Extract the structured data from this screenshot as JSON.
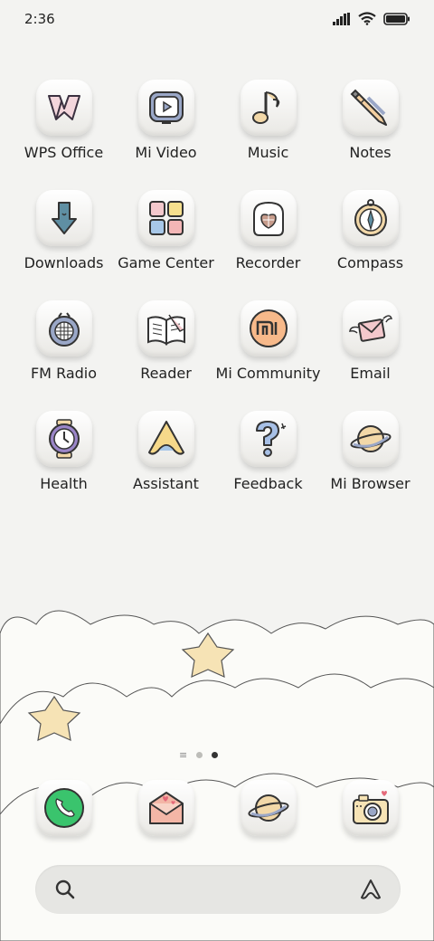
{
  "status_bar": {
    "time": "2:36"
  },
  "apps": [
    {
      "label": "WPS Office",
      "icon": "wps-office-icon"
    },
    {
      "label": "Mi Video",
      "icon": "mi-video-icon"
    },
    {
      "label": "Music",
      "icon": "music-note-icon"
    },
    {
      "label": "Notes",
      "icon": "pencil-icon"
    },
    {
      "label": "Downloads",
      "icon": "download-arrow-icon"
    },
    {
      "label": "Game Center",
      "icon": "game-center-icon"
    },
    {
      "label": "Recorder",
      "icon": "recorder-icon"
    },
    {
      "label": "Compass",
      "icon": "compass-icon"
    },
    {
      "label": "FM Radio",
      "icon": "radio-icon"
    },
    {
      "label": "Reader",
      "icon": "book-icon"
    },
    {
      "label": "Mi Community",
      "icon": "mi-community-icon"
    },
    {
      "label": "Email",
      "icon": "envelope-wings-icon"
    },
    {
      "label": "Health",
      "icon": "clock-icon"
    },
    {
      "label": "Assistant",
      "icon": "assistant-icon"
    },
    {
      "label": "Feedback",
      "icon": "question-mark-icon"
    },
    {
      "label": "Mi Browser",
      "icon": "planet-icon"
    }
  ],
  "dock": [
    {
      "name": "phone",
      "icon": "phone-icon"
    },
    {
      "name": "messages",
      "icon": "love-letter-icon"
    },
    {
      "name": "browser",
      "icon": "planet-icon"
    },
    {
      "name": "camera",
      "icon": "camera-icon"
    }
  ],
  "page_indicator": {
    "pages": 2,
    "active": 2
  },
  "colors": {
    "background": "#f3f3f1",
    "text": "#222222",
    "tile": "#f7f6f3",
    "search": "#e6e6e3"
  }
}
